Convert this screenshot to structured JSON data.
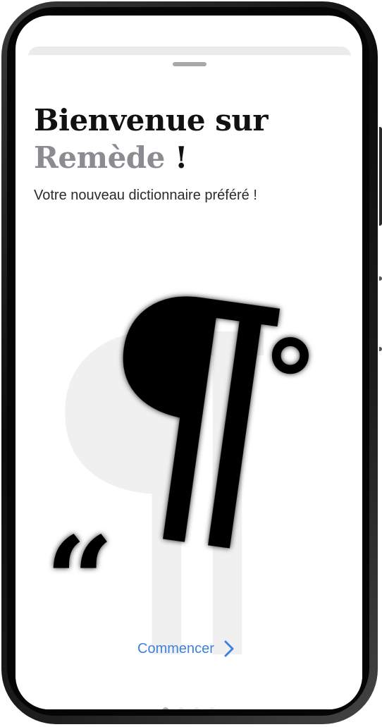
{
  "welcome": {
    "title_line1": "Bienvenue sur",
    "app_name": "Remède",
    "exclamation": " !",
    "subtitle": "Votre nouveau dictionnaire préféré !"
  },
  "illustration": {
    "glyphs": {
      "paragraph_mark": "¶",
      "opening_quote": "“",
      "degree_sign": "°"
    }
  },
  "cta": {
    "label": "Commencer",
    "icon": "chevron-right-icon"
  },
  "pagination": {
    "total": 4,
    "current": 1
  },
  "colors": {
    "app_name": "#8b8c91",
    "link": "#3d82df",
    "dot_active": "#b3b3b3",
    "dot_inactive": "#ececec"
  }
}
